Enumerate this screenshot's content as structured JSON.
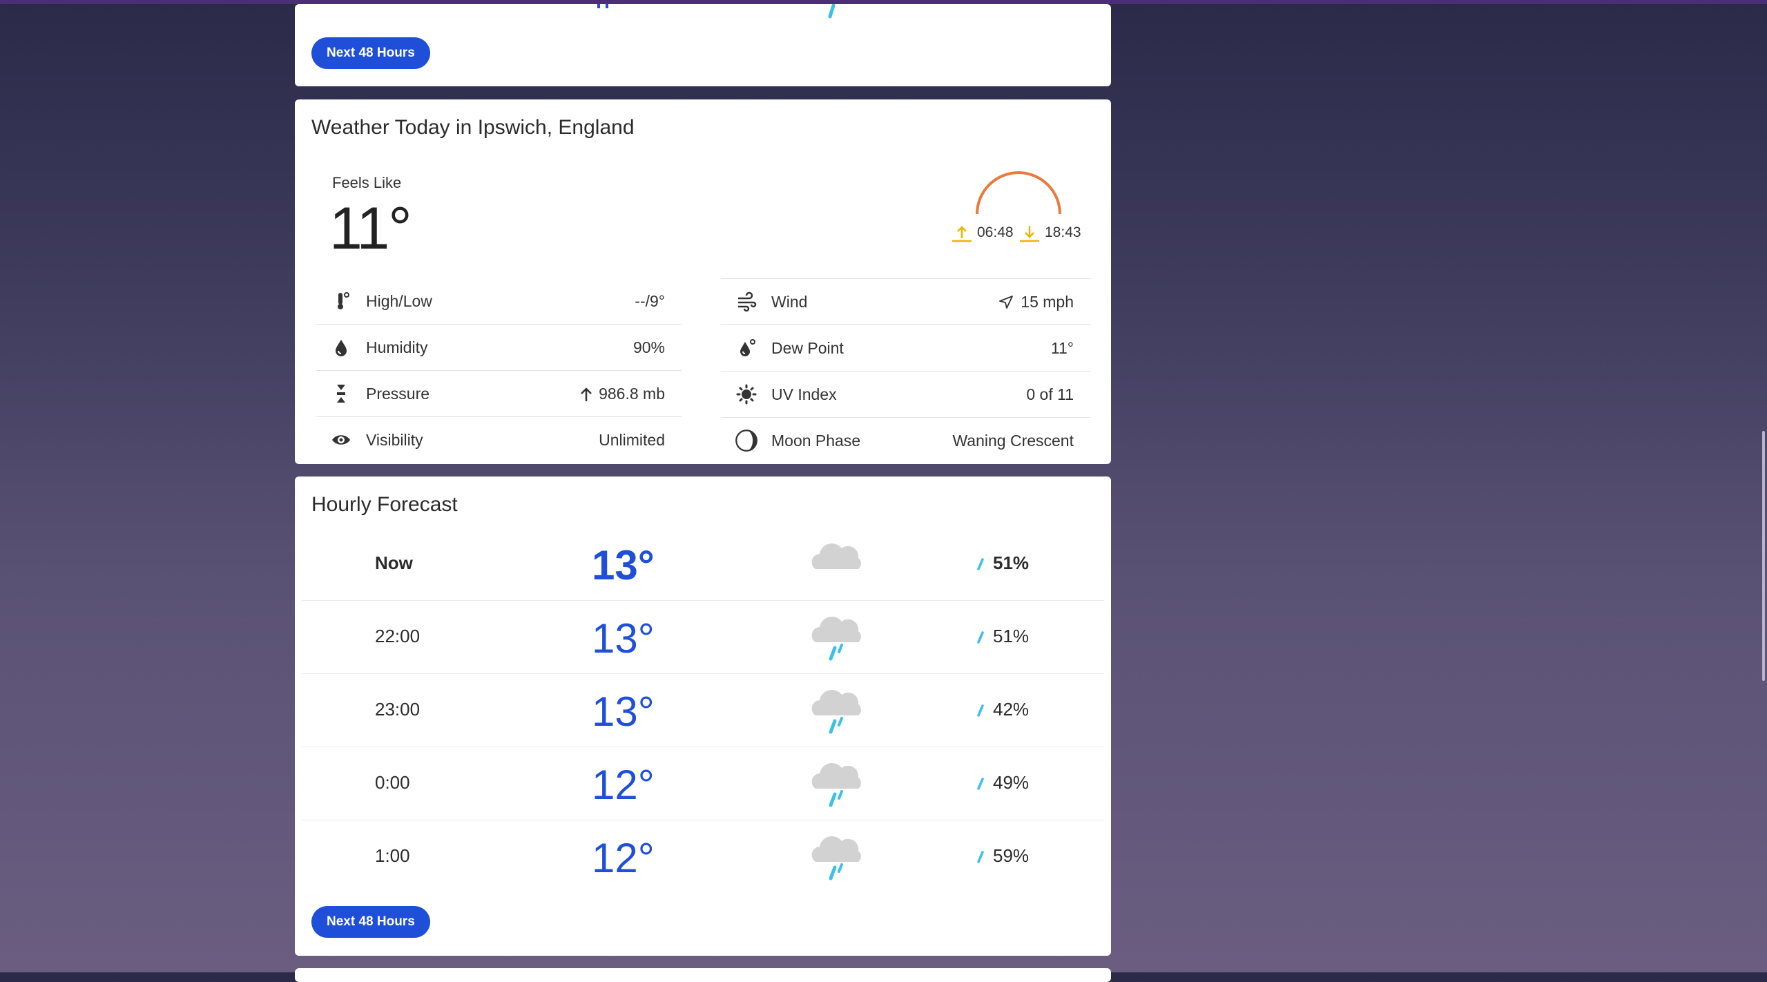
{
  "top_card": {
    "button_label": "Next 48 Hours"
  },
  "today": {
    "title": "Weather Today in Ipswich, England",
    "feels_like_label": "Feels Like",
    "feels_like_value": "11°",
    "sunrise": "06:48",
    "sunset": "18:43",
    "left_details": [
      {
        "icon": "thermometer-icon",
        "label": "High/Low",
        "value": "--/9°"
      },
      {
        "icon": "humidity-drop-icon",
        "label": "Humidity",
        "value": "90%"
      },
      {
        "icon": "pressure-icon",
        "label": "Pressure",
        "value": "986.8 mb"
      },
      {
        "icon": "eye-icon",
        "label": "Visibility",
        "value": "Unlimited"
      }
    ],
    "right_details": [
      {
        "icon": "wind-icon",
        "label": "Wind",
        "value": "15 mph"
      },
      {
        "icon": "dew-point-icon",
        "label": "Dew Point",
        "value": "11°"
      },
      {
        "icon": "uv-sun-icon",
        "label": "UV Index",
        "value": "0 of 11"
      },
      {
        "icon": "moon-phase-icon",
        "label": "Moon Phase",
        "value": "Waning Crescent"
      }
    ]
  },
  "hourly": {
    "title": "Hourly Forecast",
    "rows": [
      {
        "time": "Now",
        "temp": "13°",
        "icon": "cloud-icon",
        "precip": "51%"
      },
      {
        "time": "22:00",
        "temp": "13°",
        "icon": "rain-cloud-icon",
        "precip": "51%"
      },
      {
        "time": "23:00",
        "temp": "13°",
        "icon": "rain-cloud-icon",
        "precip": "42%"
      },
      {
        "time": "0:00",
        "temp": "12°",
        "icon": "rain-cloud-icon",
        "precip": "49%"
      },
      {
        "time": "1:00",
        "temp": "12°",
        "icon": "rain-cloud-icon",
        "precip": "59%"
      }
    ],
    "button_label": "Next 48 Hours"
  },
  "colors": {
    "accent": "#1f4fd8",
    "sun_arc": "#e87a3c",
    "sun_arrows": "#f2b400",
    "rain": "#3cc0e8"
  }
}
